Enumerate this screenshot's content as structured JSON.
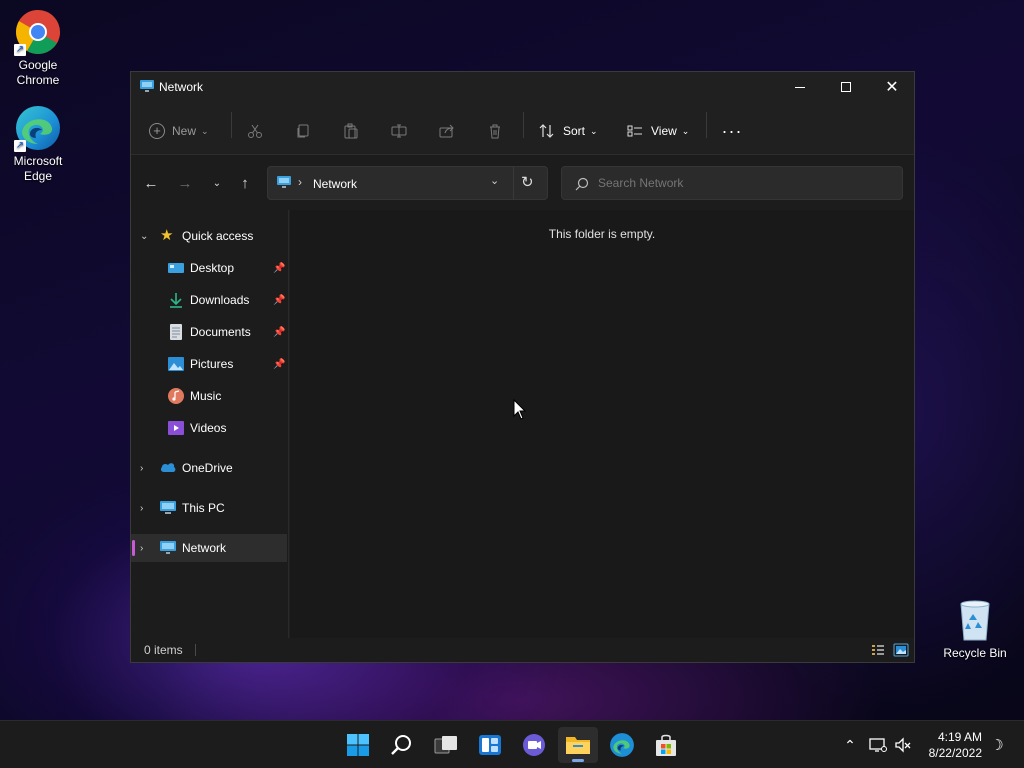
{
  "desktop": {
    "icons": [
      {
        "label": "Google Chrome"
      },
      {
        "label": "Microsoft Edge"
      },
      {
        "label": "Recycle Bin"
      }
    ]
  },
  "window": {
    "title": "Network",
    "commands": {
      "new_label": "New",
      "sort_label": "Sort",
      "view_label": "View"
    },
    "address": {
      "location": "Network"
    },
    "search": {
      "placeholder": "Search Network"
    },
    "sidebar": {
      "quick_access": "Quick access",
      "items": [
        {
          "label": "Desktop",
          "pinned": true
        },
        {
          "label": "Downloads",
          "pinned": true
        },
        {
          "label": "Documents",
          "pinned": true
        },
        {
          "label": "Pictures",
          "pinned": true
        },
        {
          "label": "Music",
          "pinned": false
        },
        {
          "label": "Videos",
          "pinned": false
        }
      ],
      "onedrive": "OneDrive",
      "this_pc": "This PC",
      "network": "Network"
    },
    "content": {
      "empty_message": "This folder is empty."
    },
    "status": {
      "item_count": "0 items"
    }
  },
  "taskbar": {
    "clock": {
      "time": "4:19 AM",
      "date": "8/22/2022"
    }
  },
  "colors": {
    "accent_selected": "#c75bd6",
    "window_bg": "#202020",
    "taskbar_bg": "#1c1c1c"
  }
}
